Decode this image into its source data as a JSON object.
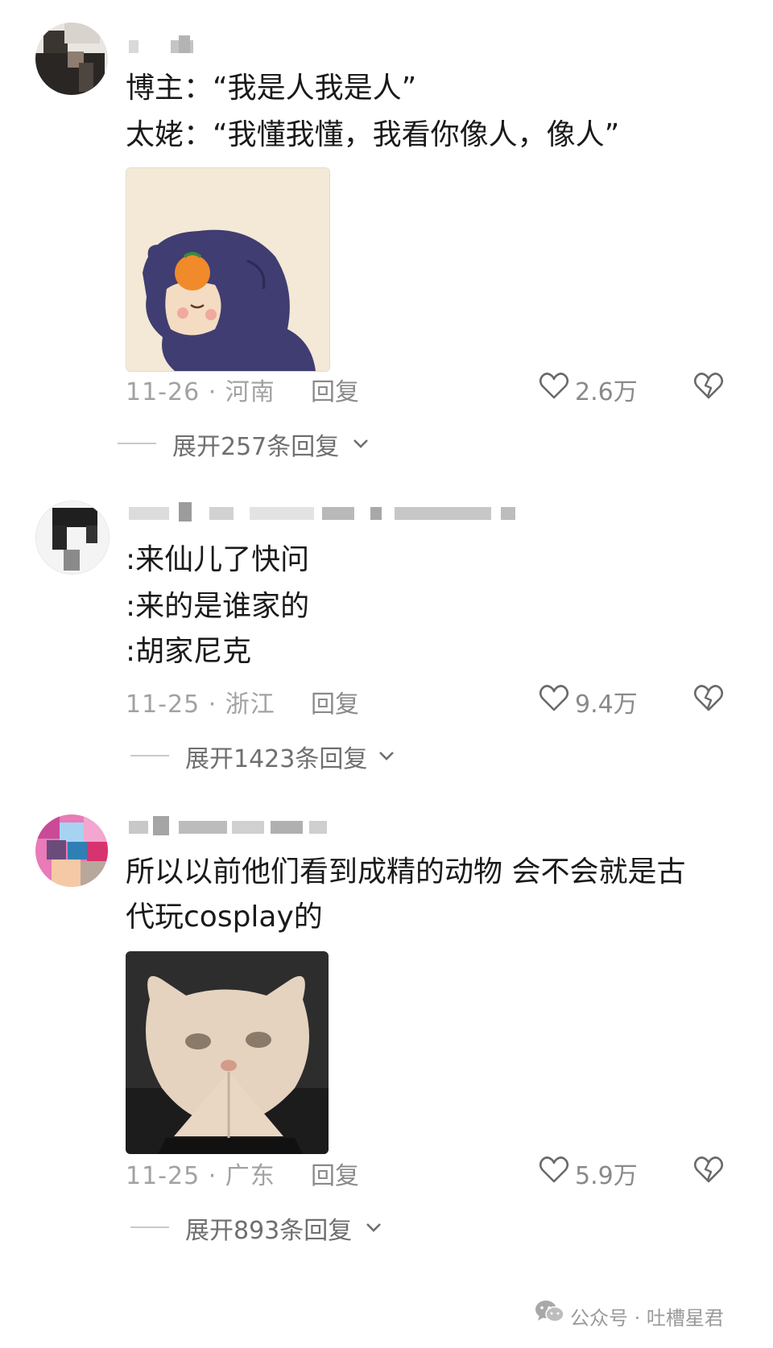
{
  "comments": [
    {
      "lines": [
        "博主：“我是人我是人”",
        "太姥：“我懂我懂，我看你像人，像人”"
      ],
      "date": "11-26 · 河南",
      "reply_label": "回复",
      "likes": "2.6万",
      "expand_label": "展开257条回复",
      "sticker": "blue-hooded-chibi-sticker"
    },
    {
      "lines": [
        ":来仙儿了快问",
        ":来的是谁家的",
        ":胡家尼克"
      ],
      "date": "11-25 · 浙江",
      "reply_label": "回复",
      "likes": "9.4万",
      "expand_label": "展开1423条回复"
    },
    {
      "lines": [
        "所以以前他们看到成精的动物 会不会就是古",
        "代玩cosplay的"
      ],
      "date": "11-25 · 广东",
      "reply_label": "回复",
      "likes": "5.9万",
      "expand_label": "展开893条回复",
      "sticker": "praying-cat-sticker"
    }
  ],
  "watermark": {
    "text": "公众号 · 吐槽星君",
    "icon": "wechat-icon"
  },
  "icons": {
    "like": "heart-icon",
    "dislike": "broken-heart-icon",
    "expand": "chevron-down-icon"
  },
  "colors": {
    "text": "#1a1a1a",
    "meta": "#a2a2a2",
    "expand": "#6f6f6f"
  }
}
